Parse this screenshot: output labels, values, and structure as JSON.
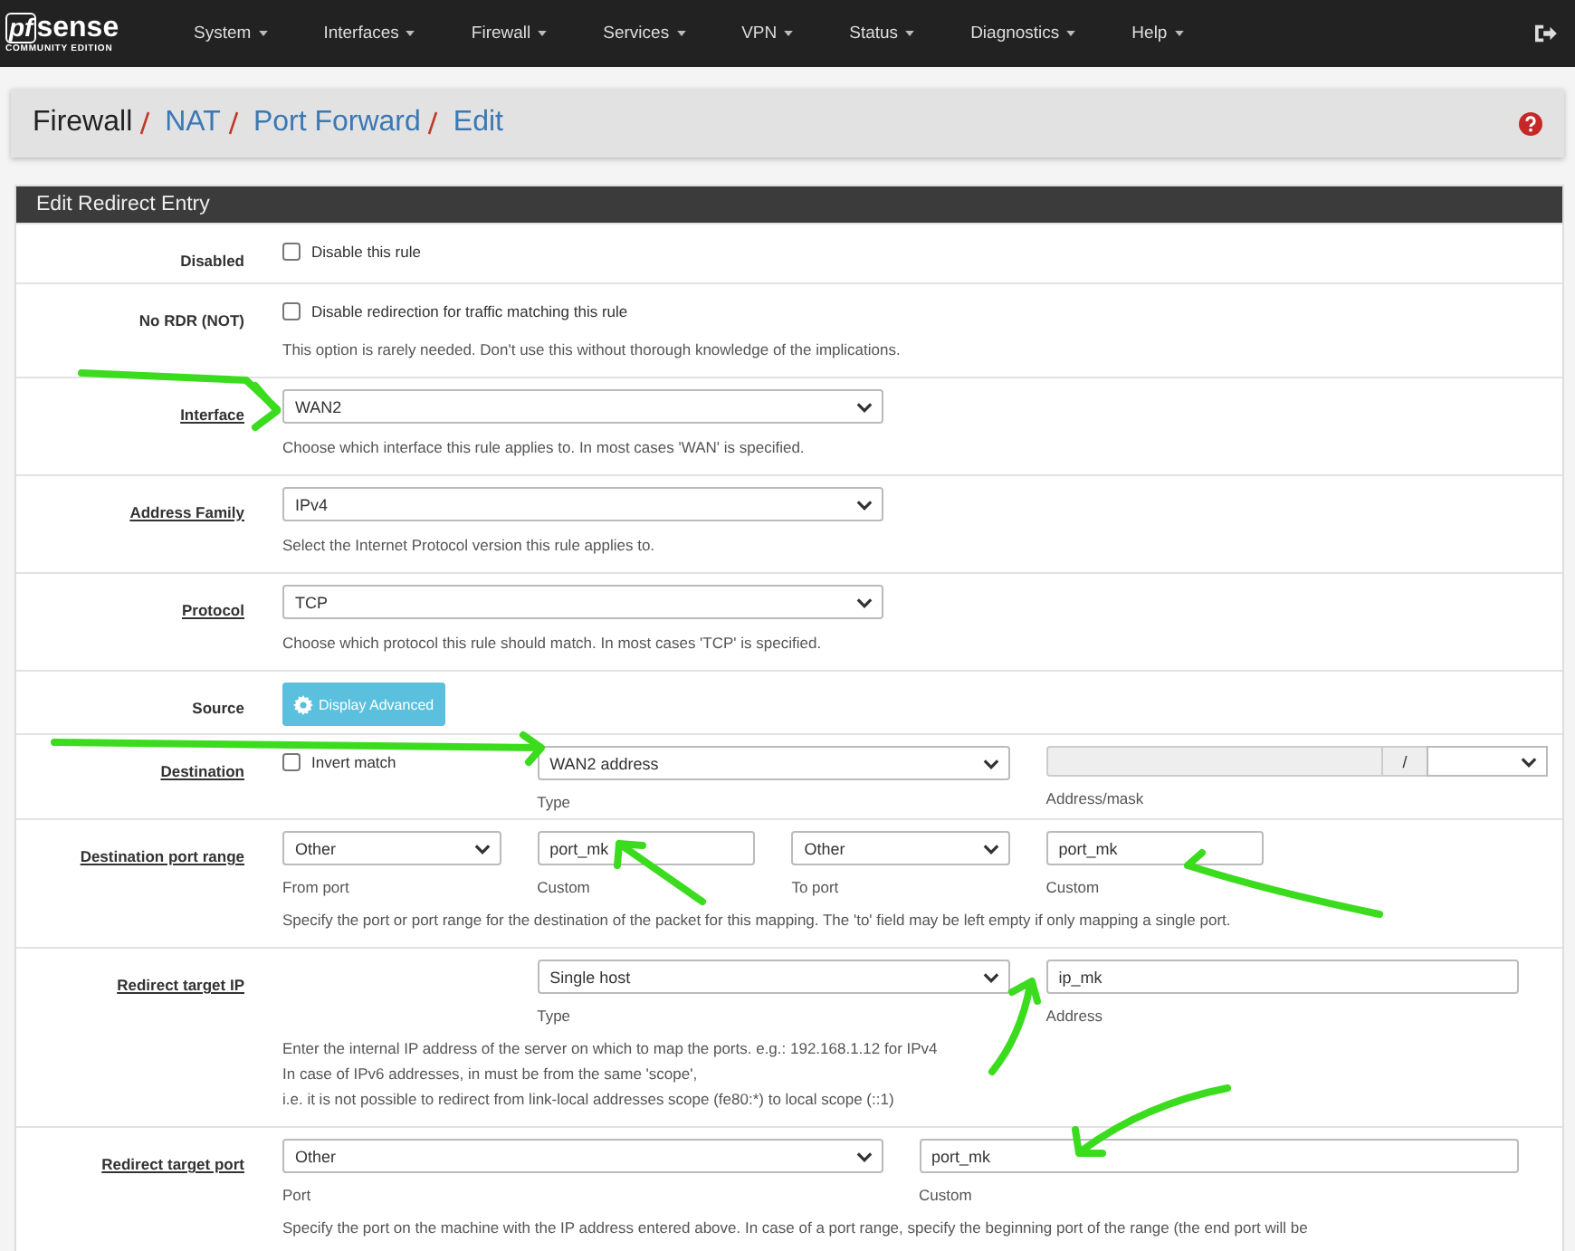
{
  "navbar": {
    "logo": {
      "mark": "pf",
      "word": "sense",
      "edition": "COMMUNITY EDITION"
    },
    "menu": [
      {
        "label": "System"
      },
      {
        "label": "Interfaces"
      },
      {
        "label": "Firewall"
      },
      {
        "label": "Services"
      },
      {
        "label": "VPN"
      },
      {
        "label": "Status"
      },
      {
        "label": "Diagnostics"
      },
      {
        "label": "Help"
      }
    ]
  },
  "breadcrumb": [
    {
      "label": "Firewall",
      "link": false
    },
    {
      "label": "NAT",
      "link": true
    },
    {
      "label": "Port Forward",
      "link": true
    },
    {
      "label": "Edit",
      "link": true
    }
  ],
  "panel": {
    "title": "Edit Redirect Entry",
    "rows": [
      {
        "kind": "single",
        "label": "Disabled",
        "required": false,
        "fields": [
          {
            "kind": "checkbox",
            "checked": false,
            "text": "Disable this rule"
          }
        ],
        "help": []
      },
      {
        "kind": "single",
        "label": "No RDR (NOT)",
        "required": false,
        "fields": [
          {
            "kind": "checkbox",
            "checked": false,
            "text": "Disable redirection for traffic matching this rule"
          }
        ],
        "help": [
          "This option is rarely needed. Don't use this without thorough knowledge of the implications."
        ]
      },
      {
        "kind": "single",
        "label": "Interface",
        "required": true,
        "fields": [
          {
            "kind": "select",
            "value": "WAN2"
          }
        ],
        "help": [
          "Choose which interface this rule applies to. In most cases 'WAN' is specified."
        ]
      },
      {
        "kind": "single",
        "label": "Address Family",
        "required": true,
        "fields": [
          {
            "kind": "select",
            "value": "IPv4"
          }
        ],
        "help": [
          "Select the Internet Protocol version this rule applies to."
        ]
      },
      {
        "kind": "single",
        "label": "Protocol",
        "required": true,
        "fields": [
          {
            "kind": "select",
            "value": "TCP"
          }
        ],
        "help": [
          "Choose which protocol this rule should match. In most cases 'TCP' is specified."
        ]
      },
      {
        "kind": "single",
        "label": "Source",
        "required": false,
        "fields": [
          {
            "kind": "button",
            "text": "Display Advanced"
          }
        ],
        "help": []
      },
      {
        "kind": "destination",
        "label": "Destination",
        "required": true,
        "fields": [
          {
            "kind": "checkbox",
            "checked": false,
            "text": "Invert match"
          },
          {
            "kind": "select",
            "value": "WAN2 address",
            "caption": "Type"
          },
          {
            "kind": "address",
            "separator": "/",
            "caption": "Address/mask"
          }
        ],
        "help": []
      },
      {
        "kind": "ports",
        "label": "Destination port range",
        "required": true,
        "fields": [
          {
            "kind": "select",
            "value": "Other",
            "caption": "From port"
          },
          {
            "kind": "input",
            "value": "port_mk",
            "caption": "Custom"
          },
          {
            "kind": "select",
            "value": "Other",
            "caption": "To port"
          },
          {
            "kind": "input",
            "value": "port_mk",
            "caption": "Custom"
          }
        ],
        "help": [
          "Specify the port or port range for the destination of the packet for this mapping. The 'to' field may be left empty if only mapping a single port."
        ]
      },
      {
        "kind": "target_ip",
        "label": "Redirect target IP",
        "required": true,
        "fields": [
          {
            "kind": "select",
            "value": "Single host",
            "caption": "Type"
          },
          {
            "kind": "input",
            "value": "ip_mk",
            "caption": "Address"
          }
        ],
        "help": [
          "Enter the internal IP address of the server on which to map the ports. e.g.: 192.168.1.12 for IPv4",
          "In case of IPv6 addresses, in must be from the same 'scope',",
          "i.e. it is not possible to redirect from link-local addresses scope (fe80:*) to local scope (::1)"
        ]
      },
      {
        "kind": "target_port",
        "label": "Redirect target port",
        "required": true,
        "fields": [
          {
            "kind": "select",
            "value": "Other",
            "caption": "Port"
          },
          {
            "kind": "input",
            "value": "port_mk",
            "caption": "Custom"
          }
        ],
        "help": [
          "Specify the port on the machine with the IP address entered above. In case of a port range, specify the beginning port of the range (the end port will be"
        ]
      }
    ]
  }
}
